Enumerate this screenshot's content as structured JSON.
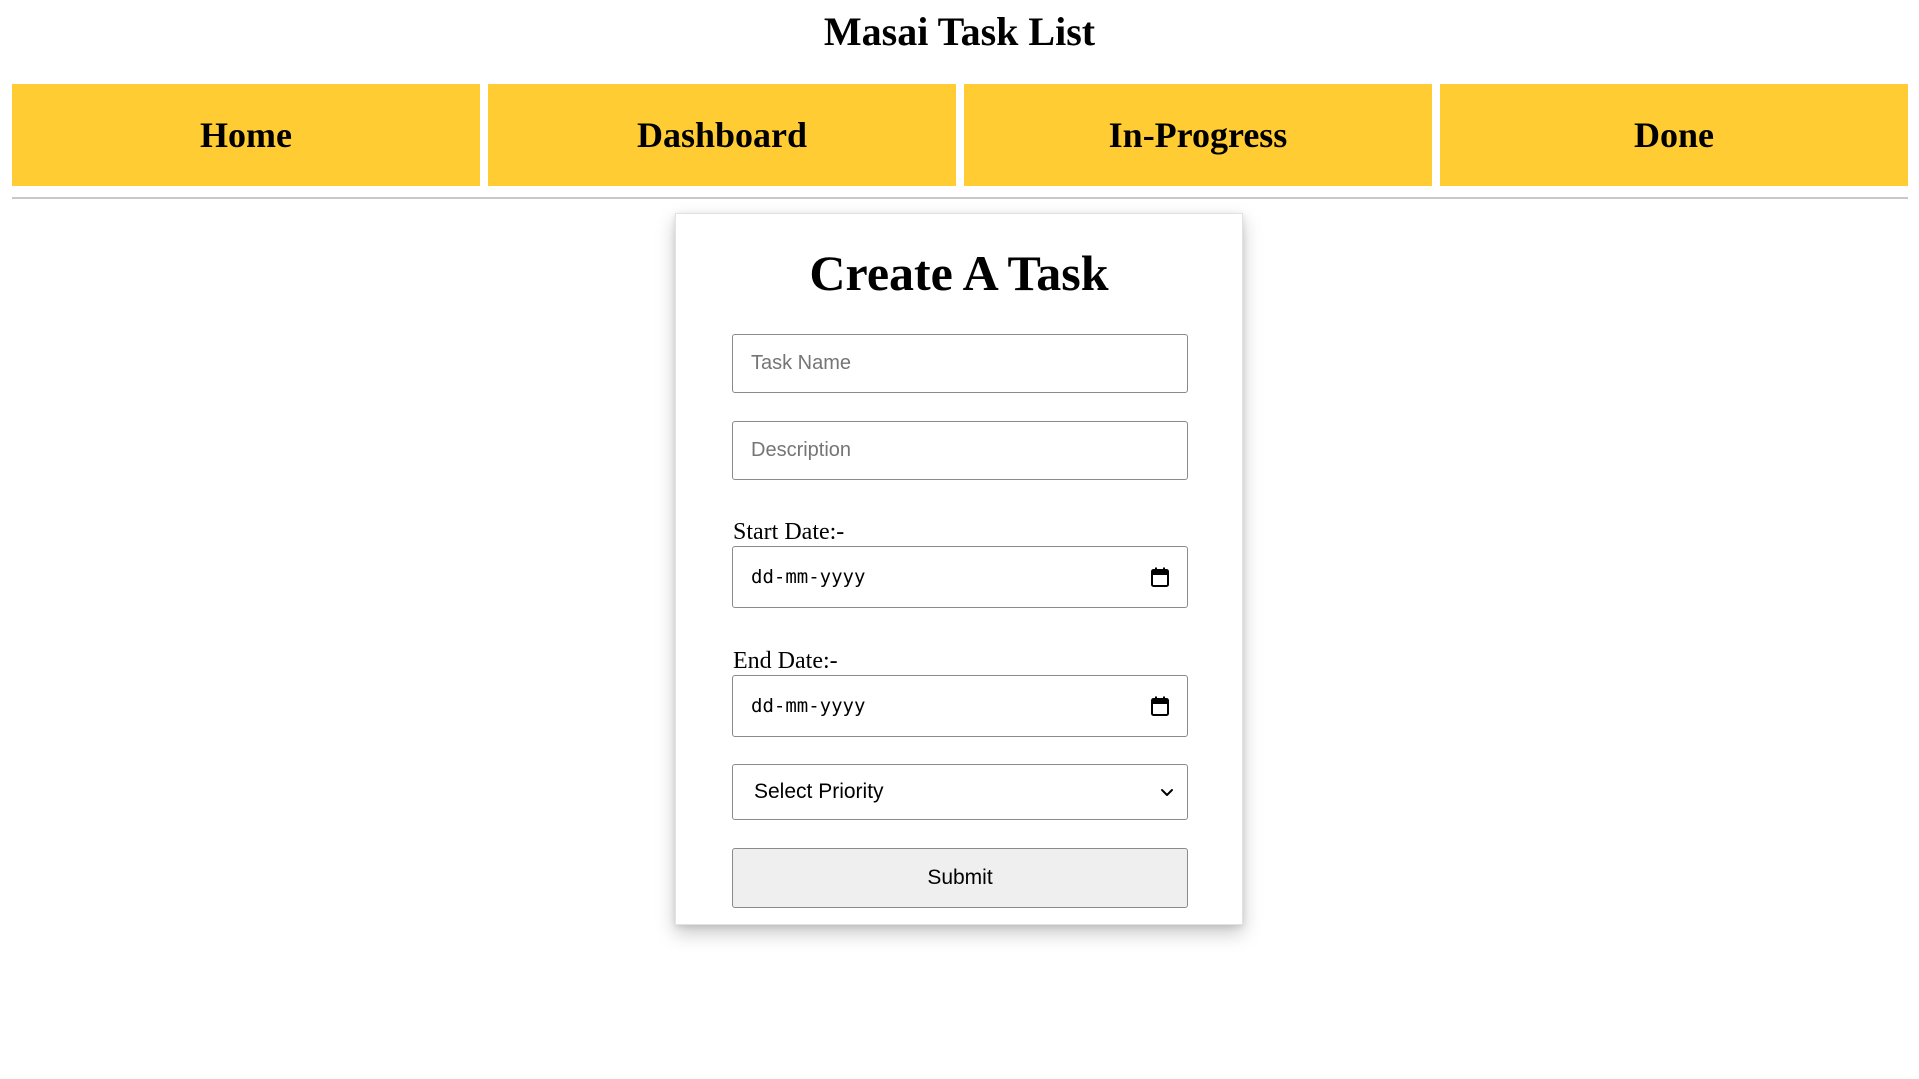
{
  "app": {
    "title": "Masai Task List"
  },
  "nav": {
    "items": [
      {
        "label": "Home"
      },
      {
        "label": "Dashboard"
      },
      {
        "label": "In-Progress"
      },
      {
        "label": "Done"
      }
    ]
  },
  "form": {
    "title": "Create A Task",
    "task_name": {
      "placeholder": "Task Name",
      "value": ""
    },
    "description": {
      "placeholder": "Description",
      "value": ""
    },
    "start_date": {
      "label": "Start Date:-",
      "value": "dd-mm-yyyy",
      "icon": "calendar-icon"
    },
    "end_date": {
      "label": "End Date:-",
      "value": "dd-mm-yyyy",
      "icon": "calendar-icon"
    },
    "priority": {
      "selected": "Select Priority",
      "icon": "chevron-down-icon"
    },
    "submit_label": "Submit"
  },
  "colors": {
    "nav_background": "#ffcc33",
    "submit_background": "#efefef",
    "divider": "#c8c8c8"
  }
}
